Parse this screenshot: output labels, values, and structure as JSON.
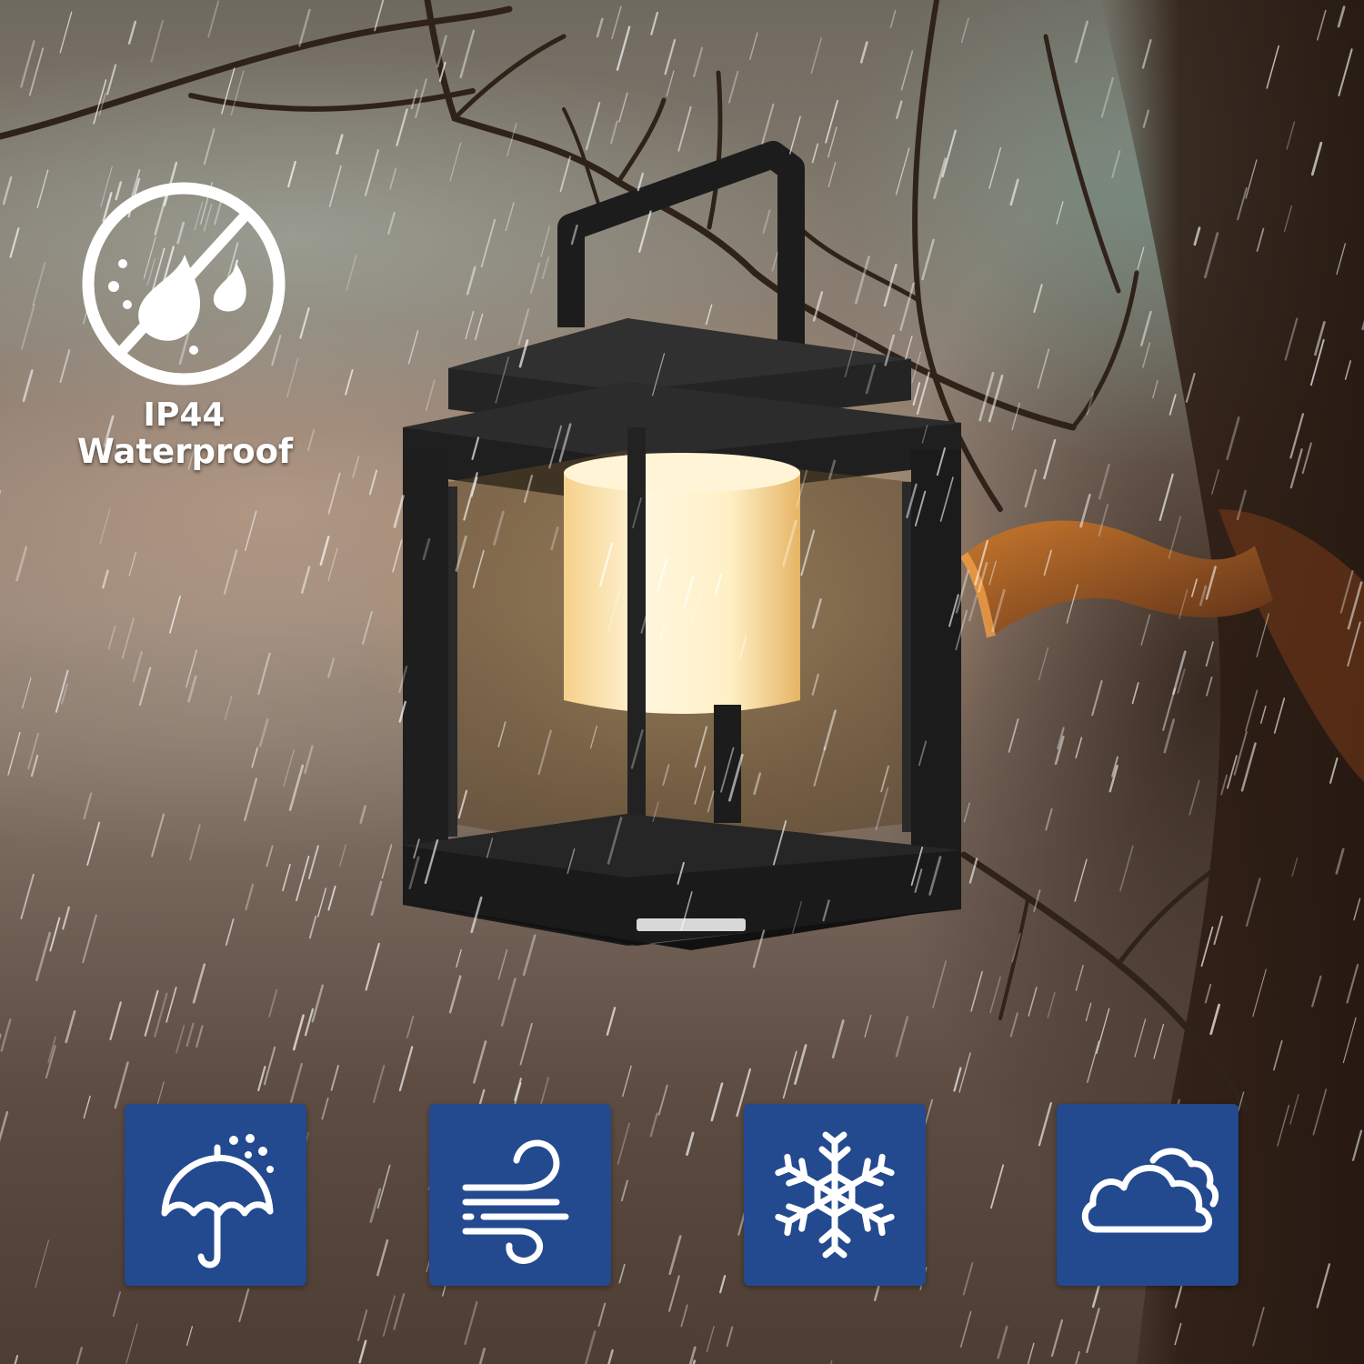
{
  "badge": {
    "icon": "no-water-drops-icon",
    "line1": "IP44",
    "line2": "Waterproof"
  },
  "scene": {
    "subject": "lantern",
    "lamp_color": "#ffe9b8",
    "frame_color": "#1e1e1e"
  },
  "weather_tiles": [
    {
      "icon": "umbrella-rain-icon"
    },
    {
      "icon": "wind-icon"
    },
    {
      "icon": "snowflake-icon"
    },
    {
      "icon": "cloud-icon"
    }
  ],
  "colors": {
    "tile_background": "#23498f",
    "icon_stroke": "#ffffff"
  }
}
